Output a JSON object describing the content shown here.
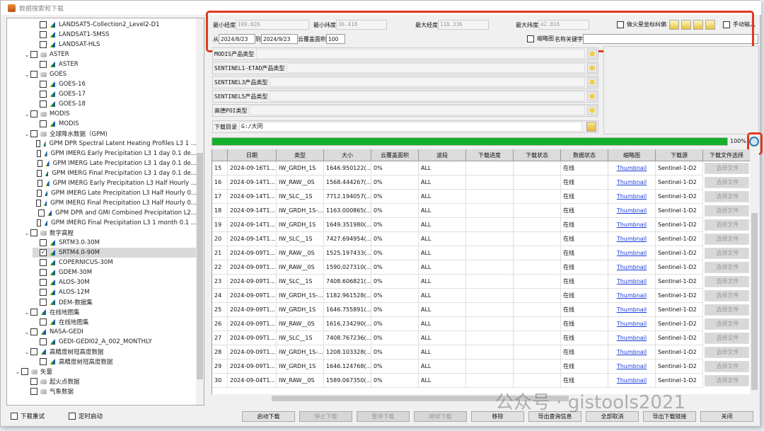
{
  "window": {
    "title": "数据搜索和下载"
  },
  "tree": [
    {
      "l": 2,
      "label": "LANDSAT5-Collection2_Level2-D1"
    },
    {
      "l": 2,
      "label": "LANDSAT1-5MSS"
    },
    {
      "l": 2,
      "label": "LANDSAT-HLS"
    },
    {
      "l": 1,
      "label": "ASTER",
      "g": true
    },
    {
      "l": 2,
      "label": "ASTER"
    },
    {
      "l": 1,
      "label": "GOES",
      "g": true
    },
    {
      "l": 2,
      "label": "GOES-16"
    },
    {
      "l": 2,
      "label": "GOES-17"
    },
    {
      "l": 2,
      "label": "GOES-18"
    },
    {
      "l": 1,
      "label": "MODIS",
      "g": true
    },
    {
      "l": 2,
      "label": "MODIS"
    },
    {
      "l": 1,
      "label": "全球降水数据（GPM)",
      "g": true
    },
    {
      "l": 2,
      "label": "GPM DPR Spectral Latent Heating Profiles L3 1 ..."
    },
    {
      "l": 2,
      "label": "GPM IMERG Early Precipitation L3 1 day 0.1 de..."
    },
    {
      "l": 2,
      "label": "GPM IMERG Late Precipitation L3 1 day 0.1 de..."
    },
    {
      "l": 2,
      "label": "GPM IMERG Final Precipitation L3 1 day 0.1 de..."
    },
    {
      "l": 2,
      "label": "GPM IMERG Early Precipitation L3 Half Hourly ..."
    },
    {
      "l": 2,
      "label": "GPM IMERG Late Precipitation L3 Half Hourly 0..."
    },
    {
      "l": 2,
      "label": "GPM IMERG Final Precipitation L3 Half Hourly 0..."
    },
    {
      "l": 2,
      "label": "GPM DPR and GMI Combined Precipitation L2..."
    },
    {
      "l": 2,
      "label": "GPM IMERG Final Precipitation L3 1 month 0.1 ..."
    },
    {
      "l": 1,
      "label": "数字高程",
      "g": true
    },
    {
      "l": 2,
      "label": "SRTM3.0-30M"
    },
    {
      "l": 2,
      "label": "SRTM4.0-90M",
      "checked": true,
      "selected": true
    },
    {
      "l": 2,
      "label": "COPERNICUS-30M"
    },
    {
      "l": 2,
      "label": "GDEM-30M"
    },
    {
      "l": 2,
      "label": "ALOS-30M"
    },
    {
      "l": 2,
      "label": "ALOS-12M"
    },
    {
      "l": 2,
      "label": "DEM-数据集"
    },
    {
      "l": 1,
      "label": "在线地图集",
      "g": true,
      "sat": true
    },
    {
      "l": 2,
      "label": "在线地图集"
    },
    {
      "l": 1,
      "label": "NASA-GEDI",
      "g": true,
      "sat": true
    },
    {
      "l": 2,
      "label": "GEDI-GEDI02_A_002_MONTHLY"
    },
    {
      "l": 1,
      "label": "高精度树冠高度数据",
      "g": true,
      "sat": true
    },
    {
      "l": 2,
      "label": "高精度树冠高度数据"
    },
    {
      "l": 0,
      "label": "矢量",
      "g": true
    },
    {
      "l": 1,
      "label": "起火点数据",
      "layer": true
    },
    {
      "l": 1,
      "label": "气象数据",
      "layer": true
    }
  ],
  "bottom_left": {
    "retry": "下载重试",
    "timer": "定时启动"
  },
  "filters": {
    "min_lon_label": "最小经度",
    "min_lon": "109.026",
    "min_lat_label": "最小纬度",
    "min_lat": "36.418",
    "max_lon_label": "最大经度",
    "max_lon": "118.336",
    "max_lat_label": "最大纬度",
    "max_lat": "42.816",
    "mars_label": "做火星坐标纠偏",
    "manual_label": "手动输入",
    "from_label": "从",
    "from": "2024/8/23",
    "to_label": "到",
    "to": "2024/9/23",
    "cloud_label": "云覆盖面积",
    "cloud": "100",
    "thumb_label": "缩略图",
    "keyword_label": "名称关键字",
    "keyword": ""
  },
  "product_types": [
    "MODIS产品类型",
    "SENTINEL1-ETAD产品类型",
    "SENTINEL3产品类型",
    "SENTINEL5产品类型",
    "高德POI类型"
  ],
  "download_dir": {
    "label": "下载目录",
    "value": "G:/大同"
  },
  "progress": {
    "value": 100,
    "label": "100%"
  },
  "colors": {
    "accent_red": "#e03a1e",
    "progress_green": "#14b02c",
    "link": "#1a3ad8"
  },
  "table": {
    "headers": [
      "日期",
      "类型",
      "大小",
      "云覆盖面积",
      "波段",
      "下载进度",
      "下载状态",
      "数据状态",
      "缩略图",
      "下载源",
      "下载文件选择"
    ],
    "rows": [
      [
        "15",
        "2024-09-16T1...",
        "IW_GRDH_1S",
        "1646.950122(...",
        "0%",
        "ALL",
        "",
        "",
        "在线",
        "Thumbnail",
        "Sentinel-1-D2",
        "选择文件"
      ],
      [
        "16",
        "2024-09-14T1...",
        "IW_RAW__0S",
        "1568.444267(...",
        "0%",
        "ALL",
        "",
        "",
        "在线",
        "Thumbnail",
        "Sentinel-1-D2",
        "选择文件"
      ],
      [
        "17",
        "2024-09-14T1...",
        "IW_SLC__1S",
        "7712.194057(...",
        "0%",
        "ALL",
        "",
        "",
        "在线",
        "Thumbnail",
        "Sentinel-1-D2",
        "选择文件"
      ],
      [
        "18",
        "2024-09-14T1...",
        "IW_GRDH_1S-...",
        "1163.000865(...",
        "0%",
        "ALL",
        "",
        "",
        "在线",
        "Thumbnail",
        "Sentinel-1-D2",
        "选择文件"
      ],
      [
        "19",
        "2024-09-14T1...",
        "IW_GRDH_1S",
        "1649.351980(...",
        "0%",
        "ALL",
        "",
        "",
        "在线",
        "Thumbnail",
        "Sentinel-1-D2",
        "选择文件"
      ],
      [
        "20",
        "2024-09-14T1...",
        "IW_SLC__1S",
        "7427.694954(...",
        "0%",
        "ALL",
        "",
        "",
        "在线",
        "Thumbnail",
        "Sentinel-1-D2",
        "选择文件"
      ],
      [
        "21",
        "2024-09-09T1...",
        "IW_RAW__0S",
        "1525.197433(...",
        "0%",
        "ALL",
        "",
        "",
        "在线",
        "Thumbnail",
        "Sentinel-1-D2",
        "选择文件"
      ],
      [
        "22",
        "2024-09-09T1...",
        "IW_RAW__0S",
        "1590.027310(...",
        "0%",
        "ALL",
        "",
        "",
        "在线",
        "Thumbnail",
        "Sentinel-1-D2",
        "选择文件"
      ],
      [
        "23",
        "2024-09-09T1...",
        "IW_SLC__1S",
        "7408.606821(...",
        "0%",
        "ALL",
        "",
        "",
        "在线",
        "Thumbnail",
        "Sentinel-1-D2",
        "选择文件"
      ],
      [
        "24",
        "2024-09-09T1...",
        "IW_GRDH_1S-...",
        "1182.961528(...",
        "0%",
        "ALL",
        "",
        "",
        "在线",
        "Thumbnail",
        "Sentinel-1-D2",
        "选择文件"
      ],
      [
        "25",
        "2024-09-09T1...",
        "IW_GRDH_1S",
        "1646.755891(...",
        "0%",
        "ALL",
        "",
        "",
        "在线",
        "Thumbnail",
        "Sentinel-1-D2",
        "选择文件"
      ],
      [
        "26",
        "2024-09-09T1...",
        "IW_RAW__0S",
        "1616.234290(...",
        "0%",
        "ALL",
        "",
        "",
        "在线",
        "Thumbnail",
        "Sentinel-1-D2",
        "选择文件"
      ],
      [
        "27",
        "2024-09-09T1...",
        "IW_SLC__1S",
        "7408.767236(...",
        "0%",
        "ALL",
        "",
        "",
        "在线",
        "Thumbnail",
        "Sentinel-1-D2",
        "选择文件"
      ],
      [
        "28",
        "2024-09-09T1...",
        "IW_GRDH_1S-...",
        "1208.103328(...",
        "0%",
        "ALL",
        "",
        "",
        "在线",
        "Thumbnail",
        "Sentinel-1-D2",
        "选择文件"
      ],
      [
        "29",
        "2024-09-09T1...",
        "IW_GRDH_1S",
        "1646.124768(...",
        "0%",
        "ALL",
        "",
        "",
        "在线",
        "Thumbnail",
        "Sentinel-1-D2",
        "选择文件"
      ],
      [
        "30",
        "2024-09-04T1...",
        "IW_RAW__0S",
        "1589.067350(...",
        "0%",
        "ALL",
        "",
        "",
        "在线",
        "Thumbnail",
        "Sentinel-1-D2",
        "选择文件"
      ]
    ]
  },
  "buttons": [
    {
      "label": "启动下载",
      "enabled": true
    },
    {
      "label": "停止下载",
      "enabled": false
    },
    {
      "label": "暂停下载",
      "enabled": false
    },
    {
      "label": "继续下载",
      "enabled": false
    },
    {
      "label": "移除",
      "enabled": true
    },
    {
      "label": "导出查询信息",
      "enabled": true
    },
    {
      "label": "全部取消",
      "enabled": true
    },
    {
      "label": "导出下载链接",
      "enabled": true
    },
    {
      "label": "关闭",
      "enabled": true
    }
  ],
  "watermark": "公众号 · gistools2021"
}
